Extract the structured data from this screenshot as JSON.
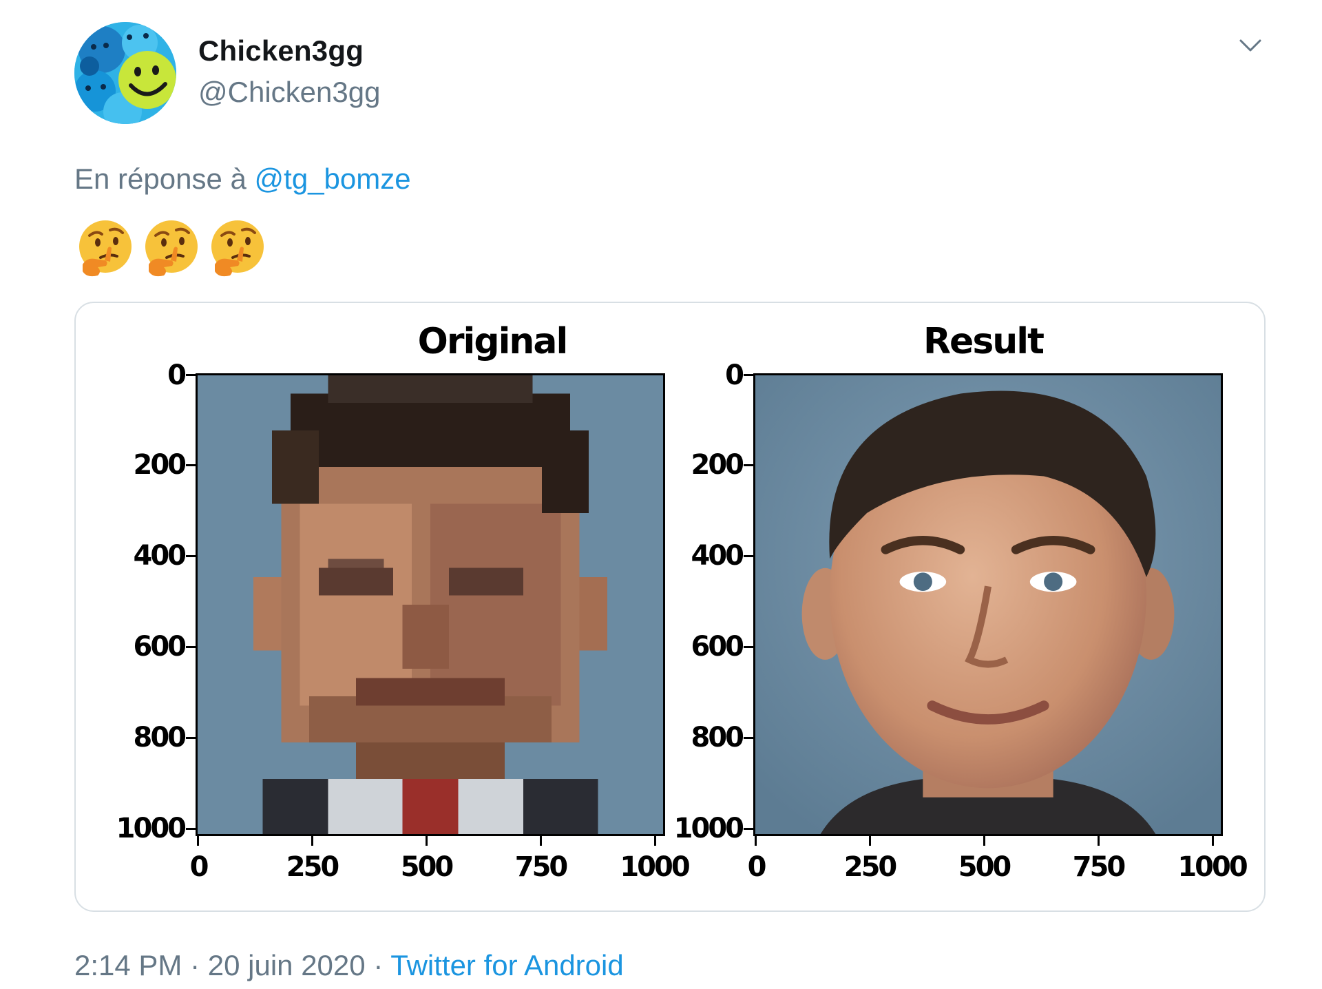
{
  "user": {
    "display_name": "Chicken3gg",
    "handle": "@Chicken3gg",
    "avatar_icon": "smiley-crowd-avatar"
  },
  "reply": {
    "prefix": "En réponse à",
    "mention": "@tg_bomze"
  },
  "tweet_text_emojis": [
    "thinking-face",
    "thinking-face",
    "thinking-face"
  ],
  "menu_icon": "chevron-down-icon",
  "media": {
    "plots": [
      {
        "title": "Original",
        "image": "pixelated-face-photo",
        "y_ticks": [
          "0",
          "200",
          "400",
          "600",
          "800",
          "1000"
        ],
        "x_ticks": [
          "0",
          "250",
          "500",
          "750",
          "1000"
        ]
      },
      {
        "title": "Result",
        "image": "upscaled-face-photo",
        "y_ticks": [
          "0",
          "200",
          "400",
          "600",
          "800",
          "1000"
        ],
        "x_ticks": [
          "0",
          "250",
          "500",
          "750",
          "1000"
        ]
      }
    ]
  },
  "footer": {
    "time": "2:14 PM",
    "separator1": "·",
    "date": "20 juin 2020",
    "separator2": "·",
    "source": "Twitter for Android"
  },
  "colors": {
    "link": "#1b95e0",
    "secondary_text": "#657786",
    "card_border": "#d8dfe4",
    "photo_background": "#6a8aa0"
  }
}
